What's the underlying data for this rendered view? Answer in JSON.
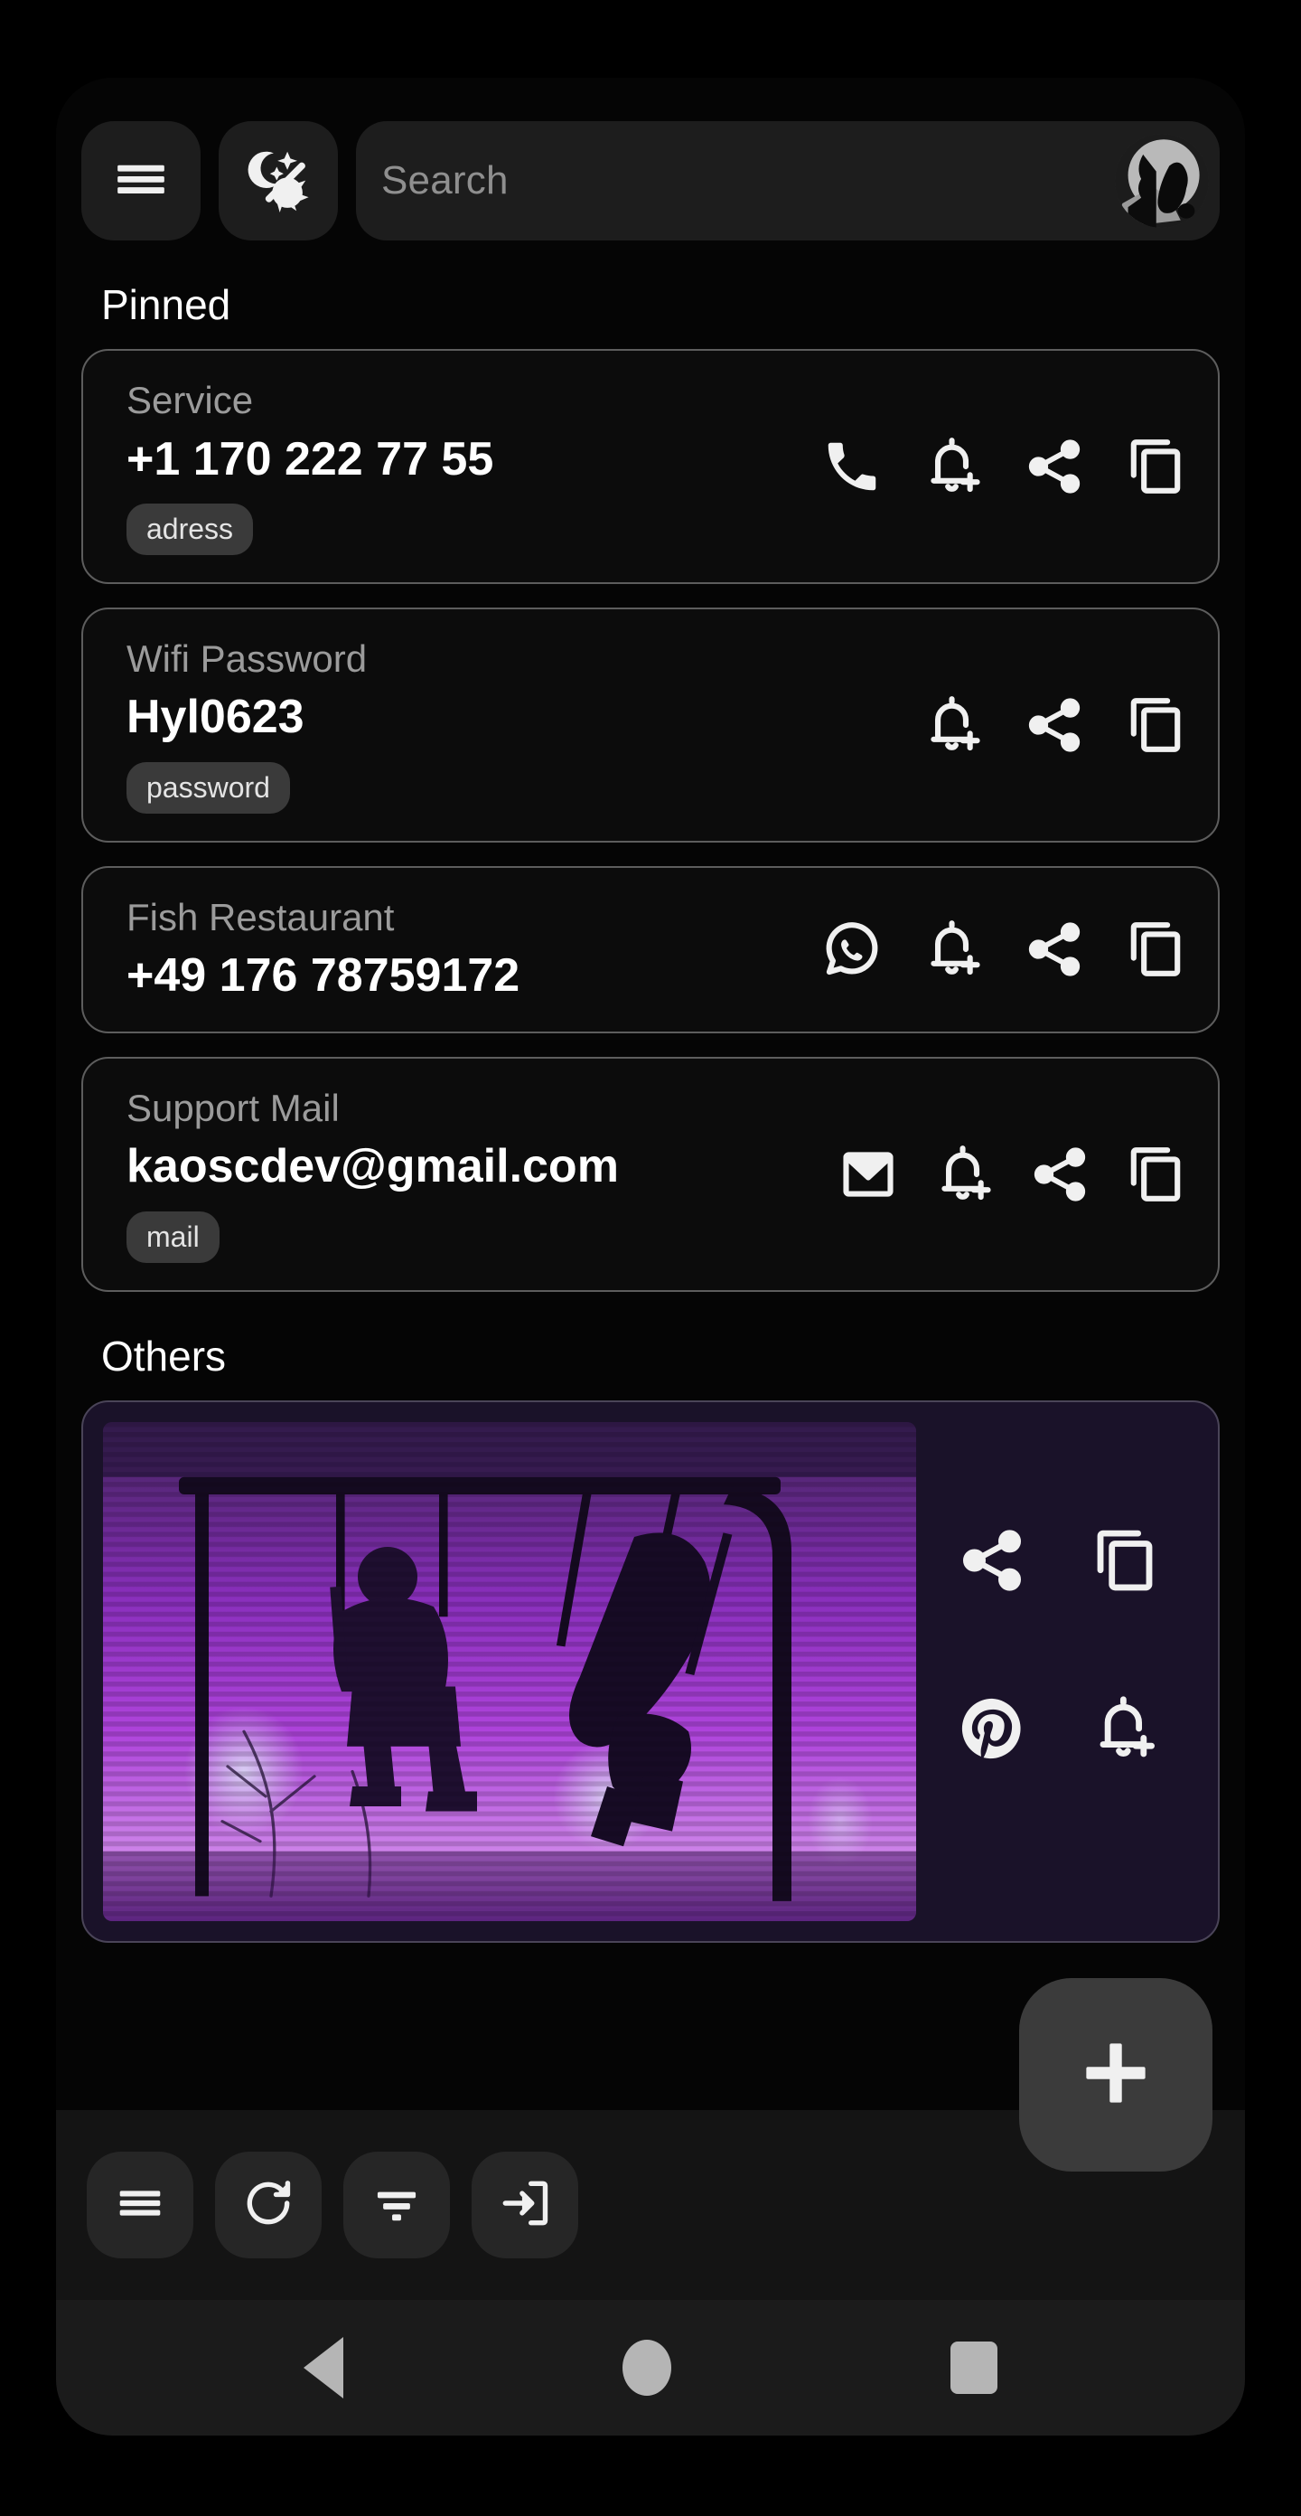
{
  "app": {
    "background_color": "#050505",
    "card_border_color": "#5d5d5d",
    "accent_purple": "#1a1229"
  },
  "topbar": {
    "menu_icon": "hamburger-menu-icon",
    "theme_toggle_icon": "night-mode-off-icon",
    "avatar_icon": "user-avatar",
    "search": {
      "placeholder": "Search",
      "value": ""
    }
  },
  "sections": [
    {
      "id": "pinned",
      "title": "Pinned"
    },
    {
      "id": "others",
      "title": "Others"
    }
  ],
  "pinned_items": [
    {
      "label": "Service",
      "value": "+1 170 222 77 55",
      "chip": "adress",
      "actions": [
        "phone-icon",
        "bell-plus-icon",
        "share-icon",
        "copy-icon"
      ]
    },
    {
      "label": "Wifi Password",
      "value": "Hyl0623",
      "chip": "password",
      "actions": [
        "bell-plus-icon",
        "share-icon",
        "copy-icon"
      ]
    },
    {
      "label": "Fish Restaurant",
      "value": "+49 176 78759172",
      "chip": "",
      "actions": [
        "whatsapp-icon",
        "bell-plus-icon",
        "share-icon",
        "copy-icon"
      ]
    },
    {
      "label": "Support Mail",
      "value": "kaoscdev@gmail.com",
      "chip": "mail",
      "actions": [
        "mail-icon",
        "bell-plus-icon",
        "share-icon",
        "copy-icon"
      ]
    }
  ],
  "others_items": [
    {
      "type": "image",
      "description": "Purple VHS-style photo of two children on swings at night",
      "actions": [
        "share-icon",
        "copy-icon",
        "pinterest-icon",
        "bell-plus-icon"
      ]
    }
  ],
  "bottombar": {
    "buttons": [
      {
        "icon": "list-menu-icon",
        "name": "list-view-button"
      },
      {
        "icon": "refresh-icon",
        "name": "refresh-button"
      },
      {
        "icon": "filter-icon",
        "name": "filter-button"
      },
      {
        "icon": "import-icon",
        "name": "import-button"
      }
    ],
    "fab": {
      "icon": "plus-icon",
      "name": "add-button"
    }
  },
  "android_nav": {
    "back": "back-triangle-icon",
    "home": "home-circle-icon",
    "recents": "recents-square-icon"
  }
}
